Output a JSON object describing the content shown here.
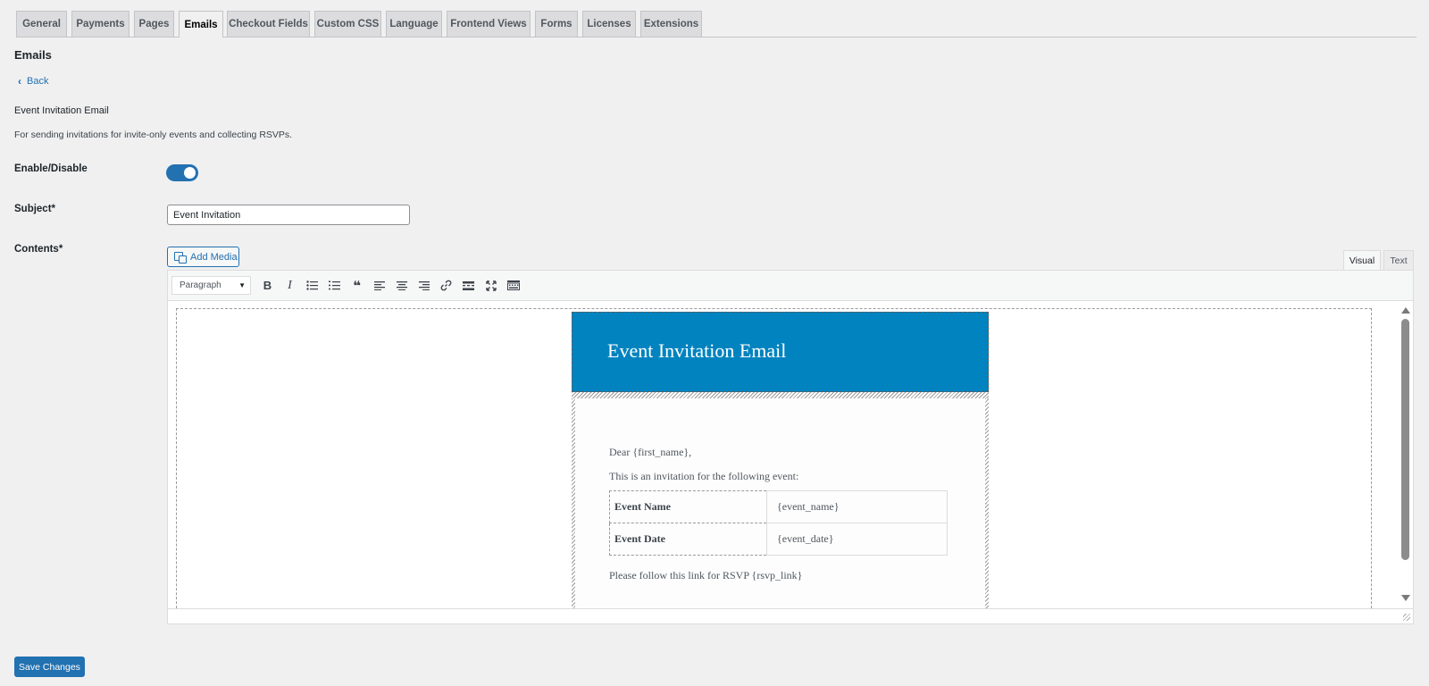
{
  "tabs": [
    {
      "label": "General",
      "active": false
    },
    {
      "label": "Payments",
      "active": false
    },
    {
      "label": "Pages",
      "active": false
    },
    {
      "label": "Emails",
      "active": true
    },
    {
      "label": "Checkout Fields",
      "active": false
    },
    {
      "label": "Custom CSS",
      "active": false
    },
    {
      "label": "Language",
      "active": false
    },
    {
      "label": "Frontend Views",
      "active": false
    },
    {
      "label": "Forms",
      "active": false
    },
    {
      "label": "Licenses",
      "active": false
    },
    {
      "label": "Extensions",
      "active": false
    }
  ],
  "page": {
    "title": "Emails",
    "back_label": "Back",
    "email_name": "Event Invitation Email",
    "email_description": "For sending invitations for invite-only events and collecting RSVPs."
  },
  "form": {
    "enable_label": "Enable/Disable",
    "enabled": true,
    "subject_label": "Subject*",
    "subject_value": "Event Invitation",
    "contents_label": "Contents*",
    "add_media_label": "Add Media"
  },
  "editor": {
    "mode_tabs": [
      "Visual",
      "Text"
    ],
    "active_mode": "Visual",
    "format_select": "Paragraph",
    "toolbar_icons": [
      "bold-icon",
      "italic-icon",
      "bulleted-list-icon",
      "numbered-list-icon",
      "blockquote-icon",
      "align-left-icon",
      "align-center-icon",
      "align-right-icon",
      "link-icon",
      "read-more-icon",
      "fullscreen-icon",
      "toolbar-toggle-icon"
    ],
    "bold_glyph": "B",
    "italic_glyph": "I",
    "quote_glyph": "❝"
  },
  "email": {
    "header_title": "Event Invitation Email",
    "header_color": "#0083bf",
    "greeting": "Dear {first_name},",
    "intro": "This is an invitation for the following event:",
    "rows": [
      {
        "key": "Event Name",
        "value": "{event_name}"
      },
      {
        "key": "Event Date",
        "value": "{event_date}"
      }
    ],
    "rsvp_line": "Please follow this link for RSVP {rsvp_link}"
  },
  "actions": {
    "save_label": "Save Changes"
  },
  "colors": {
    "accent": "#2271b1",
    "background": "#f0f0f1"
  }
}
